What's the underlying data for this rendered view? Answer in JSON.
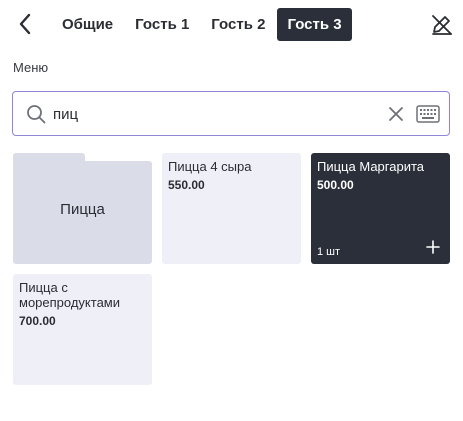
{
  "header": {
    "tabs": [
      {
        "label": "Общие"
      },
      {
        "label": "Гость 1"
      },
      {
        "label": "Гость 2"
      },
      {
        "label": "Гость 3"
      }
    ],
    "active_tab_index": 3
  },
  "menu": {
    "section_label": "Меню",
    "search": {
      "value": "пиц",
      "placeholder": ""
    },
    "folder": {
      "label": "Пицца"
    },
    "items": [
      {
        "name": "Пицца 4 сыра",
        "price": "550.00"
      },
      {
        "name": "Пицца Маргарита",
        "price": "500.00",
        "quantity": "1 шт",
        "selected": true
      },
      {
        "name": "Пицца с морепродуктами",
        "price": "700.00"
      }
    ]
  },
  "icons": {
    "back": "chevron-left-icon",
    "edit_off": "edit-off-icon",
    "search": "search-icon",
    "clear": "close-icon",
    "keyboard": "keyboard-icon",
    "add": "plus-icon"
  },
  "colors": {
    "accent_dark": "#2b2f3a",
    "card_bg": "#efeff7",
    "folder_bg": "#dadce8",
    "search_border": "#8f86d9"
  }
}
